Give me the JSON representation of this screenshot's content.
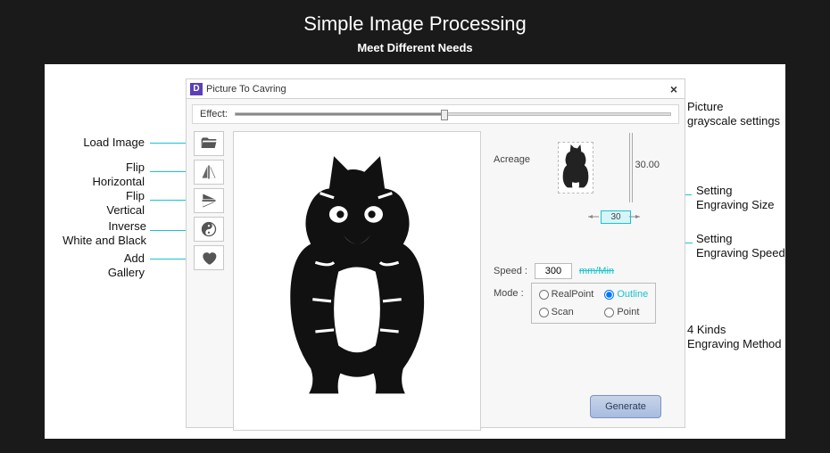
{
  "page": {
    "title": "Simple Image Processing",
    "subtitle": "Meet Different Needs"
  },
  "dialog": {
    "title": "Picture To Cavring",
    "effect_label": "Effect:"
  },
  "toolbar": {
    "load_image": "Load Image",
    "flip_horizontal": "Flip Horizontal",
    "flip_vertical": "Flip Vertical",
    "inverse": "Inverse White and Black",
    "add_gallery": "Add Gallery"
  },
  "acreage": {
    "label": "Acreage",
    "height": "30.00",
    "width": "30"
  },
  "speed": {
    "label": "Speed :",
    "value": "300",
    "unit": "mm/Min"
  },
  "mode": {
    "label": "Mode :",
    "options": {
      "realpoint": "RealPoint",
      "outline": "Outline",
      "scan": "Scan",
      "point": "Point"
    },
    "selected": "outline"
  },
  "buttons": {
    "generate": "Generate"
  },
  "callouts": {
    "load_image": "Load Image",
    "flip_h_1": "Flip",
    "flip_h_2": "Horizontal",
    "flip_v_1": "Flip",
    "flip_v_2": "Vertical",
    "inverse_1": "Inverse",
    "inverse_2": "White and Black",
    "add_1": "Add",
    "add_2": "Gallery",
    "grayscale_1": "Picture",
    "grayscale_2": "grayscale settings",
    "size_1": "Setting",
    "size_2": "Engraving Size",
    "speed_1": "Setting",
    "speed_2": "Engraving Speed",
    "method_1": "4 Kinds",
    "method_2": "Engraving Method"
  }
}
